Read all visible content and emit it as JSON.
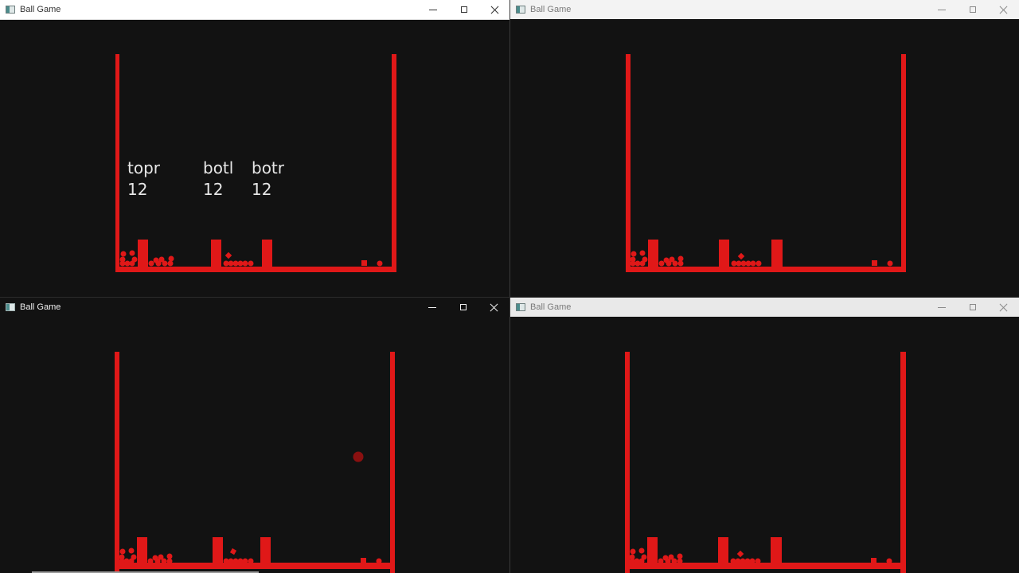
{
  "windows": [
    {
      "id": "w1",
      "title": "Ball Game",
      "hud": [
        {
          "label": "topr",
          "value": "12"
        },
        {
          "label": "botl",
          "value": "12"
        },
        {
          "label": "botr",
          "value": "12"
        }
      ]
    },
    {
      "id": "w2",
      "title": "Ball Game"
    },
    {
      "id": "w3",
      "title": "Ball Game"
    },
    {
      "id": "w4",
      "title": "Ball Game"
    }
  ],
  "colors": {
    "wall": "#e01818",
    "background": "#121212",
    "falling_ball": "#8a1010",
    "hud_text": "#e6e6e6"
  },
  "icons": {
    "app": "window-app-icon",
    "minimize": "minimize-icon",
    "maximize": "maximize-icon",
    "close": "close-icon"
  }
}
